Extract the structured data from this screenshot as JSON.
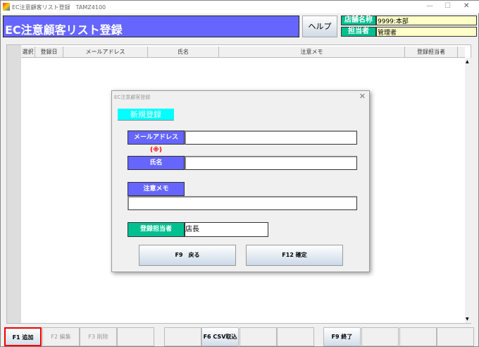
{
  "window": {
    "title": "EC注意顧客リスト登録　TAMZ4100",
    "minimize": "—",
    "maximize": "☐",
    "close": "✕"
  },
  "header": {
    "title": "EC注意顧客リスト登録",
    "help": "ヘルプ",
    "store_label": "店舗名称",
    "store_value": "9999:本部",
    "staff_label": "担当者",
    "staff_value": "管理者"
  },
  "table": {
    "columns": [
      "選択",
      "登録日",
      "メールアドレス",
      "氏名",
      "注意メモ",
      "登録担当者"
    ]
  },
  "dialog": {
    "title": "EC注意顧客登録",
    "mode": "新規登録",
    "email_label": "メールアドレス",
    "required_mark": "(※)",
    "name_label": "氏名",
    "memo_label": "注意メモ",
    "staff_label": "登録担当者",
    "staff_value": "店長",
    "email_value": "",
    "name_value": "",
    "memo_value": "",
    "back": "F9　戻る",
    "confirm": "F12 確定"
  },
  "fkeys": [
    "F1 追加",
    "F2 編集",
    "F3 削除",
    "",
    "",
    "F6 CSV取込",
    "",
    "",
    "F9 終了",
    "",
    "",
    ""
  ],
  "colors": {
    "title_bg": "#6666ff",
    "label_green": "#00c090",
    "highlight": "#ff0000"
  }
}
